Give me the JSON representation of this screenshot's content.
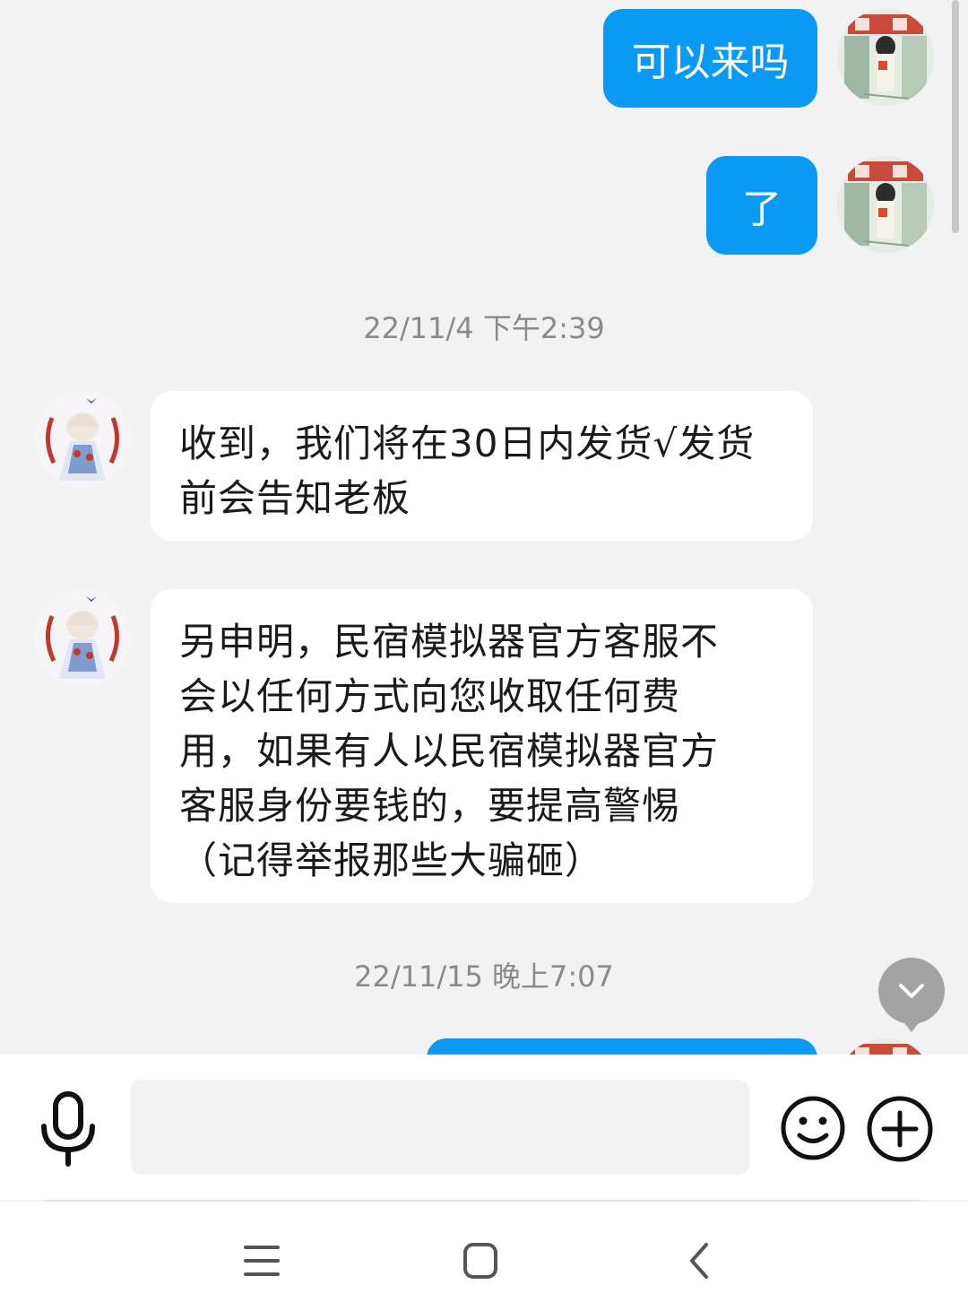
{
  "messages": {
    "out1": "可以来吗",
    "out2": "了",
    "in1": "收到，我们将在30日内发货√发货前会告知老板",
    "in2": "另申明，民宿模拟器官方客服不会以任何方式向您收取任何费用，如果有人以民宿模拟器官方客服身份要钱的，要提高警惕（记得举报那些大骗砸）",
    "in1_lines": [
      "收到，我们将在30日内发货√发货",
      "前会告知老板"
    ],
    "in2_lines": [
      "另申明，民宿模拟器官方客服不",
      "会以任何方式向您收取任何费",
      "用，如果有人以民宿模拟器官方",
      "客服身份要钱的，要提高警惕",
      "（记得举报那些大骗砸）"
    ]
  },
  "timestamps": {
    "t1": "22/11/4 下午2:39",
    "t2": "22/11/15 晚上7:07"
  },
  "icons": {
    "scroll_down": "chevron-down-icon",
    "mic": "microphone-icon",
    "emoji": "smiley-icon",
    "plus": "plus-circle-icon",
    "nav_menu": "menu-icon",
    "nav_home": "home-square-icon",
    "nav_back": "back-chevron-icon"
  },
  "colors": {
    "outgoing_bubble": "#0a99f5",
    "incoming_bubble": "#ffffff",
    "chat_background": "#f2f2f2",
    "timestamp_text": "#8a8a8a"
  }
}
